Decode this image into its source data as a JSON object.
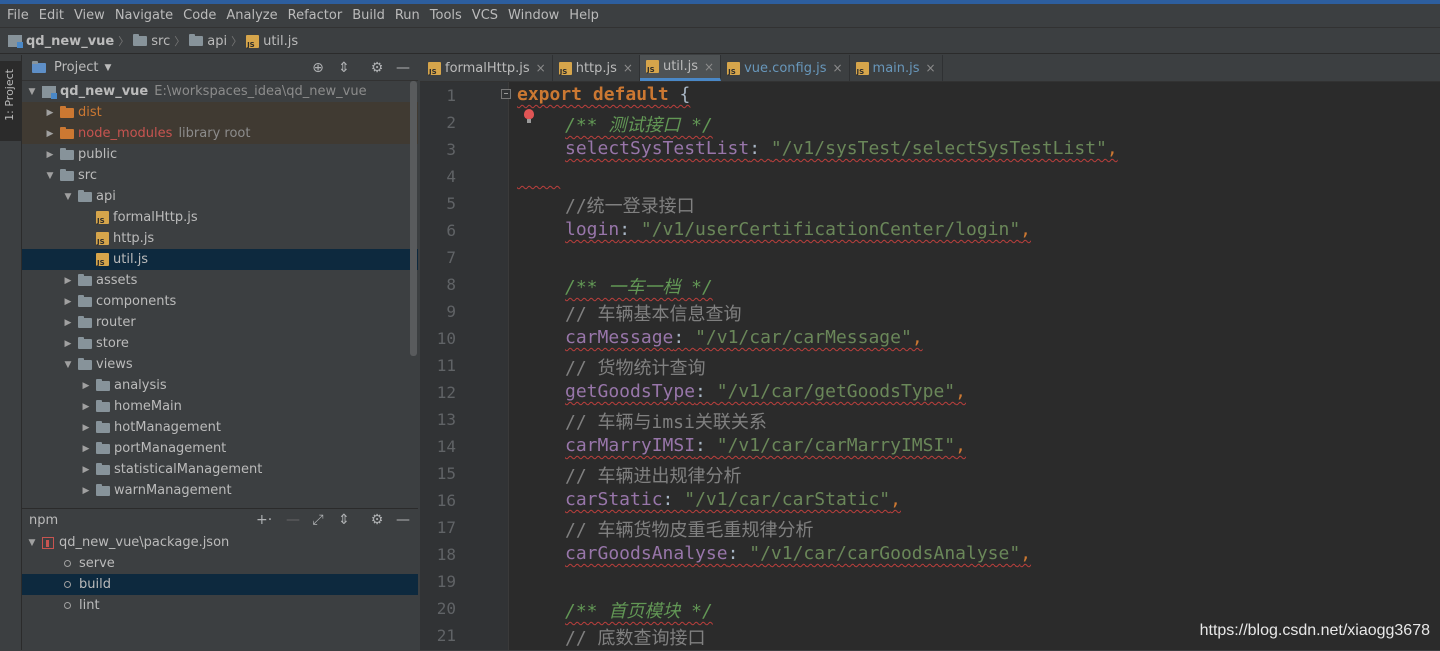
{
  "menu": [
    "File",
    "Edit",
    "View",
    "Navigate",
    "Code",
    "Analyze",
    "Refactor",
    "Build",
    "Run",
    "Tools",
    "VCS",
    "Window",
    "Help"
  ],
  "breadcrumb": {
    "project": "qd_new_vue",
    "items": [
      "src",
      "api"
    ],
    "file": "util.js"
  },
  "sidebar_tab": "1: Project",
  "project_panel": {
    "title": "Project",
    "root": {
      "name": "qd_new_vue",
      "path": "E:\\workspaces_idea\\qd_new_vue"
    },
    "items": [
      {
        "name": "dist",
        "hint": ""
      },
      {
        "name": "node_modules",
        "hint": "library root"
      },
      {
        "name": "public",
        "hint": ""
      },
      {
        "name": "src",
        "hint": ""
      },
      {
        "name": "api",
        "hint": ""
      },
      {
        "name": "formalHttp.js",
        "hint": ""
      },
      {
        "name": "http.js",
        "hint": ""
      },
      {
        "name": "util.js",
        "hint": ""
      },
      {
        "name": "assets",
        "hint": ""
      },
      {
        "name": "components",
        "hint": ""
      },
      {
        "name": "router",
        "hint": ""
      },
      {
        "name": "store",
        "hint": ""
      },
      {
        "name": "views",
        "hint": ""
      },
      {
        "name": "analysis",
        "hint": ""
      },
      {
        "name": "homeMain",
        "hint": ""
      },
      {
        "name": "hotManagement",
        "hint": ""
      },
      {
        "name": "portManagement",
        "hint": ""
      },
      {
        "name": "statisticalManagement",
        "hint": ""
      },
      {
        "name": "warnManagement",
        "hint": ""
      }
    ]
  },
  "npm_panel": {
    "title": "npm",
    "package": "qd_new_vue\\package.json",
    "scripts": [
      "serve",
      "build",
      "lint"
    ]
  },
  "tabs": [
    {
      "label": "formalHttp.js"
    },
    {
      "label": "http.js"
    },
    {
      "label": "util.js"
    },
    {
      "label": "vue.config.js"
    },
    {
      "label": "main.js"
    }
  ],
  "editor": {
    "line_numbers": [
      "1",
      "2",
      "3",
      "4",
      "5",
      "6",
      "7",
      "8",
      "9",
      "10",
      "11",
      "12",
      "13",
      "14",
      "15",
      "16",
      "17",
      "18",
      "19",
      "20",
      "21"
    ],
    "tokens": {
      "l1_kw": "export default",
      "l1_brace": " {",
      "l2_doc": "/** 测试接口 */",
      "l3_prop": "selectSysTestList",
      "l3_str": "\"/v1/sysTest/selectSysTestList\"",
      "l5_cmt": "//统一登录接口",
      "l6_prop": "login",
      "l6_str": "\"/v1/userCertificationCenter/login\"",
      "l8_doc": "/** 一车一档 */",
      "l9_cmt": "// 车辆基本信息查询",
      "l10_prop": "carMessage",
      "l10_str": "\"/v1/car/carMessage\"",
      "l11_cmt": "// 货物统计查询",
      "l12_prop": "getGoodsType",
      "l12_str": "\"/v1/car/getGoodsType\"",
      "l13_cmt": "// 车辆与imsi关联关系",
      "l14_prop": "carMarryIMSI",
      "l14_str": "\"/v1/car/carMarryIMSI\"",
      "l15_cmt": "// 车辆进出规律分析",
      "l16_prop": "carStatic",
      "l16_str": "\"/v1/car/carStatic\"",
      "l17_cmt": "// 车辆货物皮重毛重规律分析",
      "l18_prop": "carGoodsAnalyse",
      "l18_str": "\"/v1/car/carGoodsAnalyse\"",
      "l20_doc": "/** 首页模块 */",
      "l21_cmt": "// 底数查询接口",
      "colon": ": ",
      "comma": ","
    }
  },
  "watermark": "https://blog.csdn.net/xiaogg3678"
}
